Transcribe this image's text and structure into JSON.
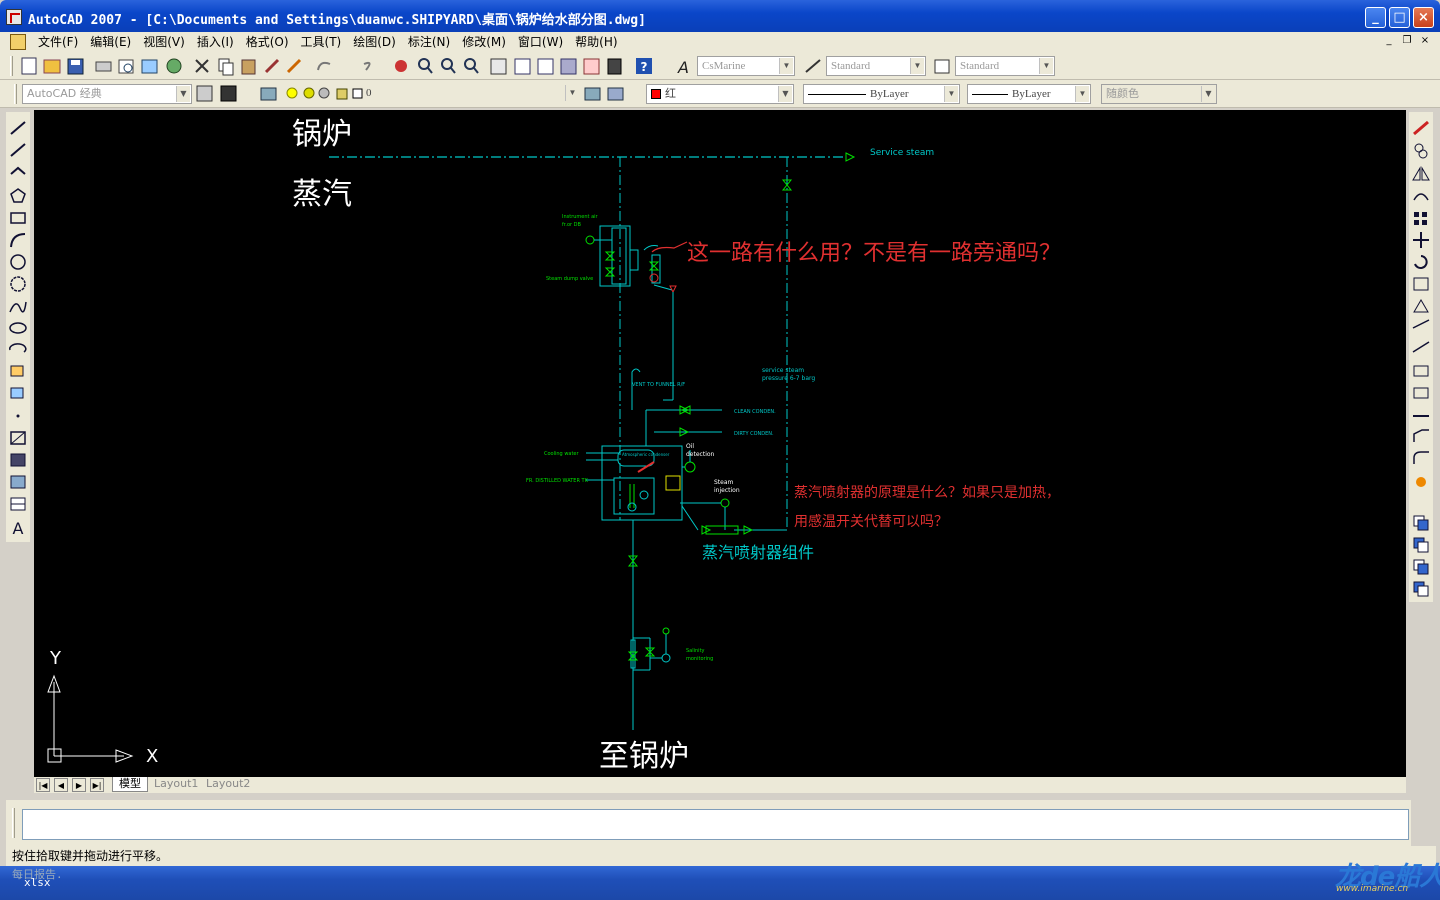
{
  "window": {
    "title": "AutoCAD 2007 - [C:\\Documents and Settings\\duanwc.SHIPYARD\\桌面\\锅炉给水部分图.dwg]",
    "min": "_",
    "max": "□",
    "close": "×"
  },
  "menu": {
    "items": [
      "文件(F)",
      "编辑(E)",
      "视图(V)",
      "插入(I)",
      "格式(O)",
      "工具(T)",
      "绘图(D)",
      "标注(N)",
      "修改(M)",
      "窗口(W)",
      "帮助(H)"
    ]
  },
  "toolbar": {
    "text_style": "CsMarine",
    "dim_style": "Standard",
    "table_style": "Standard",
    "workspace": "AutoCAD 经典",
    "layer": "0",
    "color": "红",
    "color_hex": "#ff0000",
    "linetype": "ByLayer",
    "lineweight": "ByLayer",
    "plotstyle": "随颜色"
  },
  "drawing": {
    "label_boiler": "锅炉",
    "label_steam": "蒸汽",
    "label_to_boiler": "至锅炉",
    "service_steam": "Service steam",
    "service_steam_pressure_1": "service steam",
    "service_steam_pressure_2": "pressure 6-7 barg",
    "note_1": "这一路有什么用？不是有一路旁通吗？",
    "note_2_line1": "蒸汽喷射器的原理是什么？如果只是加热，",
    "note_2_line2": "用感温开关代替可以吗？",
    "note_3": "蒸汽喷射器组件",
    "instr_air": "Instrument air",
    "instr_air2": "fr.or DB",
    "steam_dump": "Steam dump valve",
    "vent": "VENT TO FUNNEL R/F",
    "clean_cond": "CLEAN CONDEN.",
    "dirty_cond": "DIRTY CONDEN.",
    "cooling_water": "Cooling water",
    "distilled": "FR. DISTILLED WATER TK",
    "atmos": "Atmospheric condenser",
    "oil_det1": "Oil",
    "oil_det2": "detection",
    "steam_inj1": "Steam",
    "steam_inj2": "injection",
    "salinity1": "Salinity",
    "salinity2": "monitoring",
    "axis_x": "X",
    "axis_y": "Y"
  },
  "tabs": [
    "模型",
    "Layout1",
    "Layout2"
  ],
  "status_text": "按住拾取键并拖动进行平移。",
  "taskbar": {
    "line1": "每日报告.",
    "line2": "xlsx"
  },
  "watermark": {
    "text": "龙de船人",
    "url": "www.imarine.cn"
  },
  "colors": {
    "cad_cyan": "#00c8c8",
    "cad_green": "#00e000",
    "annotation_red": "#e03030"
  }
}
